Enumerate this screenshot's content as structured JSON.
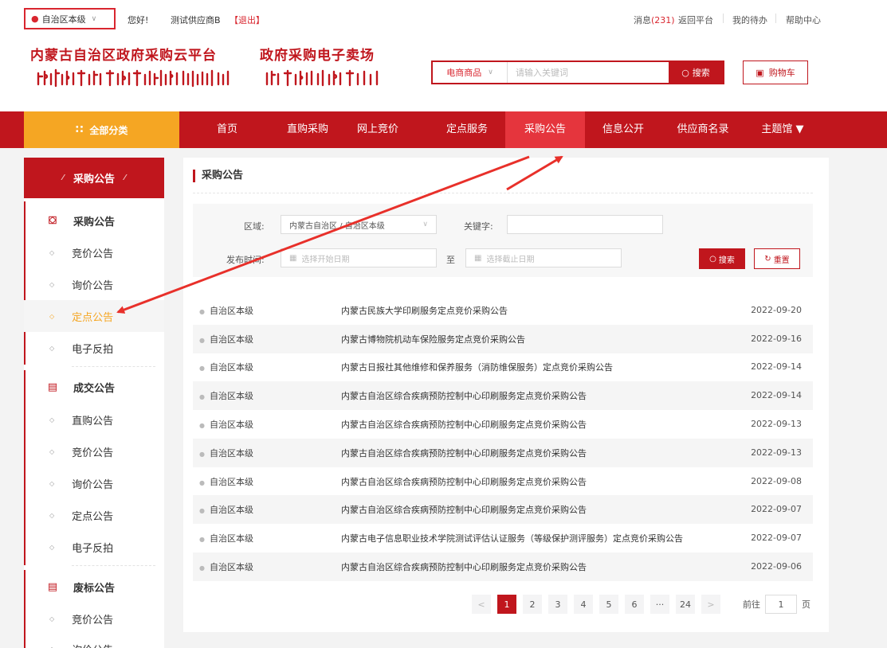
{
  "topbar": {
    "location": "自治区本级",
    "greeting": "您好!",
    "supplier": "测试供应商B",
    "logout": "【退出】",
    "messages_label": "消息",
    "messages_count": "(231)",
    "back_platform": "返回平台",
    "my_todo": "我的待办",
    "help_center": "帮助中心"
  },
  "header": {
    "brand_title": "内蒙古自治区政府采购云平台",
    "brand_subtitle": "政府采购电子卖场",
    "search_category": "电商商品",
    "search_placeholder": "请输入关键词",
    "search_button": "搜索",
    "cart_button": "购物车"
  },
  "nav": {
    "all_categories": "全部分类",
    "items": [
      "首页",
      "直购采购",
      "网上竞价",
      "定点服务",
      "采购公告",
      "信息公开",
      "供应商名录",
      "主题馆 ▼"
    ]
  },
  "sidebar": {
    "header": "采购公告",
    "groups": [
      {
        "title": "采购公告",
        "icon": "bag-icon",
        "items": [
          "竞价公告",
          "询价公告",
          "定点公告",
          "电子反拍"
        ]
      },
      {
        "title": "成交公告",
        "icon": "document-icon",
        "items": [
          "直购公告",
          "竞价公告",
          "询价公告",
          "定点公告",
          "电子反拍"
        ]
      },
      {
        "title": "废标公告",
        "icon": "document-icon",
        "items": [
          "竞价公告",
          "询价公告"
        ]
      }
    ]
  },
  "main": {
    "title": "采购公告",
    "filter": {
      "region_label": "区域:",
      "region_value": "内蒙古自治区 / 自治区本级",
      "keyword_label": "关键字:",
      "date_label": "发布时间:",
      "start_placeholder": "选择开始日期",
      "to_label": "至",
      "end_placeholder": "选择截止日期",
      "search_button": "搜索",
      "reset_button": "重置"
    },
    "rows": [
      {
        "region": "自治区本级",
        "title": "内蒙古民族大学印刷服务定点竞价采购公告",
        "date": "2022-09-20"
      },
      {
        "region": "自治区本级",
        "title": "内蒙古博物院机动车保险服务定点竞价采购公告",
        "date": "2022-09-16"
      },
      {
        "region": "自治区本级",
        "title": "内蒙古日报社其他维修和保养服务（消防维保服务）定点竞价采购公告",
        "date": "2022-09-14"
      },
      {
        "region": "自治区本级",
        "title": "内蒙古自治区综合疾病预防控制中心印刷服务定点竞价采购公告",
        "date": "2022-09-14"
      },
      {
        "region": "自治区本级",
        "title": "内蒙古自治区综合疾病预防控制中心印刷服务定点竞价采购公告",
        "date": "2022-09-13"
      },
      {
        "region": "自治区本级",
        "title": "内蒙古自治区综合疾病预防控制中心印刷服务定点竞价采购公告",
        "date": "2022-09-13"
      },
      {
        "region": "自治区本级",
        "title": "内蒙古自治区综合疾病预防控制中心印刷服务定点竞价采购公告",
        "date": "2022-09-08"
      },
      {
        "region": "自治区本级",
        "title": "内蒙古自治区综合疾病预防控制中心印刷服务定点竞价采购公告",
        "date": "2022-09-07"
      },
      {
        "region": "自治区本级",
        "title": "内蒙古电子信息职业技术学院测试评估认证服务（等级保护测评服务）定点竞价采购公告",
        "date": "2022-09-07"
      },
      {
        "region": "自治区本级",
        "title": "内蒙古自治区综合疾病预防控制中心印刷服务定点竞价采购公告",
        "date": "2022-09-06"
      }
    ],
    "pager": {
      "prev": "<",
      "pages": [
        "1",
        "2",
        "3",
        "4",
        "5",
        "6",
        "···",
        "24"
      ],
      "next": ">",
      "goto_label": "前往",
      "goto_value": "1",
      "page_unit": "页"
    }
  },
  "colors": {
    "brand_red": "#c0161d",
    "accent_orange": "#f5a623",
    "annotation_red": "#e8302a"
  }
}
